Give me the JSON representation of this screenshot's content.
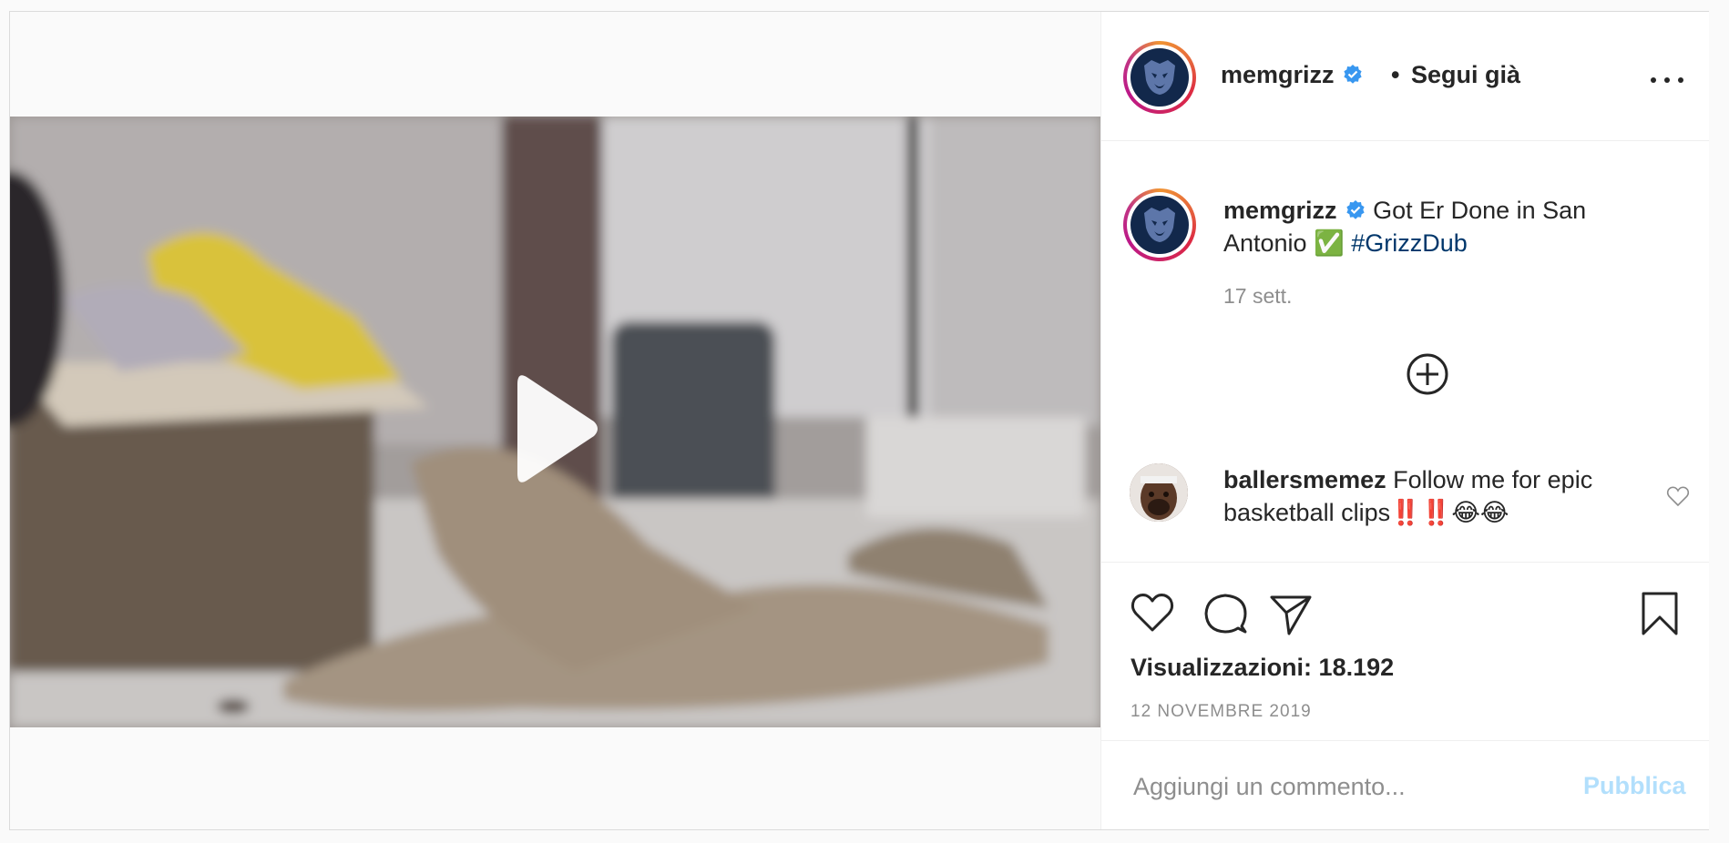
{
  "post": {
    "author": {
      "username": "memgrizz",
      "verified_icon": "verified-badge-icon",
      "separator": "•",
      "follow_label": "Segui già",
      "more_icon": "more-options-icon"
    },
    "media": {
      "type": "video",
      "play_icon": "play-icon"
    },
    "caption": {
      "username": "memgrizz",
      "text_before_emoji": "Got Er Done in San Antonio",
      "emoji": "✅",
      "hashtag": "#GrizzDub",
      "time": "17 sett."
    },
    "load_more_icon": "plus-circle-icon",
    "comment": {
      "username": "ballersmemez",
      "text": "Follow me for epic basketball clips‼️‼️😂😂",
      "like_icon": "heart-icon"
    },
    "actions": {
      "like_icon": "heart-icon",
      "comment_icon": "comment-bubble-icon",
      "share_icon": "paper-plane-icon",
      "save_icon": "bookmark-icon"
    },
    "views_text": "Visualizzazioni: 18.192",
    "date_text": "12 NOVEMBRE 2019",
    "add_comment": {
      "placeholder": "Aggiungi un commento...",
      "publish_label": "Pubblica"
    },
    "colors": {
      "hashtag": "#00376b",
      "verified": "#3897f0",
      "publish_disabled": "#b2dffc",
      "secondary_text": "#8e8e8e"
    }
  }
}
